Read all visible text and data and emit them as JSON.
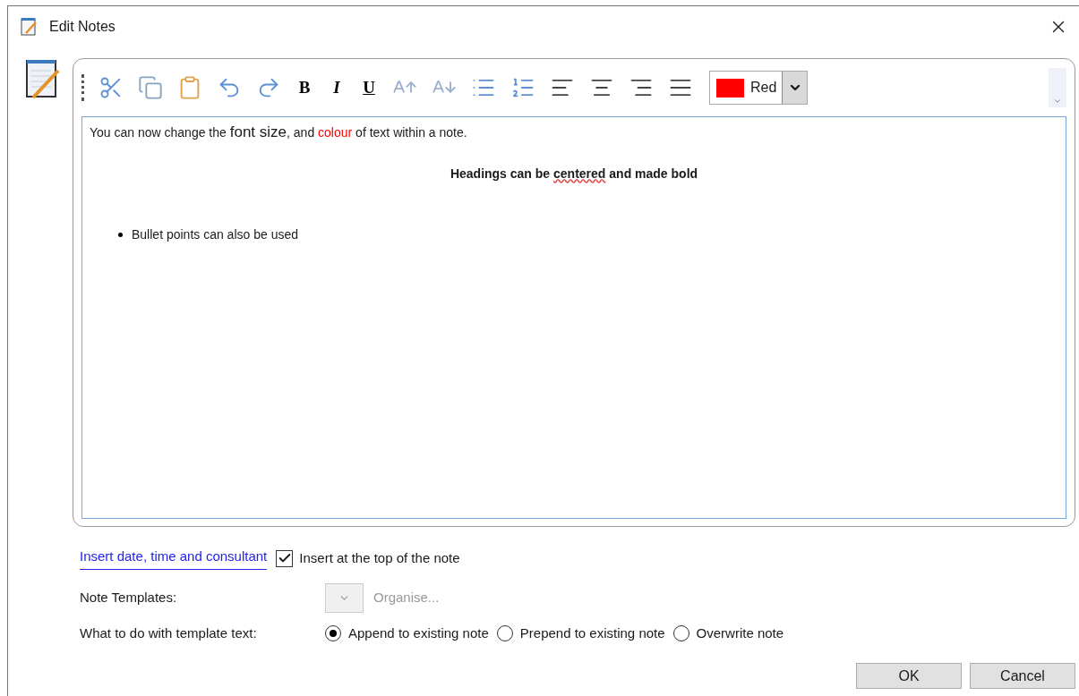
{
  "window": {
    "title": "Edit Notes"
  },
  "toolbar": {
    "buttons": [
      {
        "kind": "cut"
      },
      {
        "kind": "copy"
      },
      {
        "kind": "paste"
      },
      {
        "kind": "undo"
      },
      {
        "kind": "redo"
      },
      {
        "kind": "bold",
        "label": "B"
      },
      {
        "kind": "italic",
        "label": "I"
      },
      {
        "kind": "underline",
        "label": "U"
      },
      {
        "kind": "grow"
      },
      {
        "kind": "shrink"
      },
      {
        "kind": "bullets"
      },
      {
        "kind": "numbers"
      },
      {
        "kind": "align-left"
      },
      {
        "kind": "align-center"
      },
      {
        "kind": "align-right"
      },
      {
        "kind": "justify"
      }
    ],
    "color_picker": {
      "label": "Red",
      "color": "#ff0000"
    }
  },
  "editor": {
    "paragraphs": [
      {
        "kind": "text",
        "segments": [
          {
            "text": "You can now change the ",
            "kind": "normal"
          },
          {
            "text": "font size",
            "kind": "large"
          },
          {
            "text": ", and ",
            "kind": "normal"
          },
          {
            "text": "colour",
            "kind": "red"
          },
          {
            "text": " of text within a note.",
            "kind": "normal"
          }
        ]
      },
      {
        "kind": "heading",
        "segments": [
          {
            "text": "Headings can be ",
            "kind": "normal"
          },
          {
            "text": "centered",
            "kind": "misspelled"
          },
          {
            "text": " and made bold",
            "kind": "normal"
          }
        ]
      },
      {
        "kind": "bullet",
        "segments": [
          {
            "text": "Bullet points can also be used",
            "kind": "normal"
          }
        ]
      }
    ]
  },
  "insert_link": "Insert date, time and consultant",
  "insert_top": {
    "label": "Insert at the top of the note",
    "checked": true
  },
  "templates": {
    "label": "Note Templates:",
    "organise": "Organise...",
    "disabled": true
  },
  "template_action": {
    "label": "What to do with template text:",
    "options": [
      {
        "label": "Append to existing note",
        "selected": true
      },
      {
        "label": "Prepend to existing note",
        "selected": false
      },
      {
        "label": "Overwrite note",
        "selected": false
      }
    ]
  },
  "buttons": [
    "OK",
    "Cancel"
  ]
}
